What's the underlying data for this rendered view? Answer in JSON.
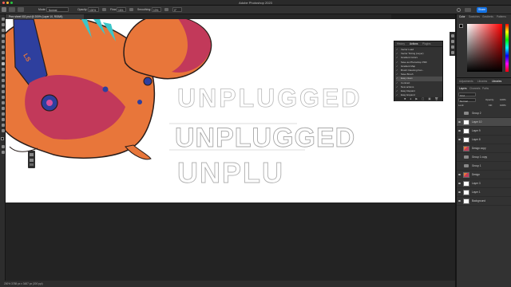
{
  "app": {
    "title": "Adobe Photoshop 2023"
  },
  "options_bar": {
    "mode_label": "Mode:",
    "mode_value": "Normal",
    "opacity_label": "Opacity:",
    "opacity_value": "100%",
    "flow_label": "Flow:",
    "flow_value": "16%",
    "smoothing_label": "Smoothing:",
    "smoothing_value": "10%",
    "angle_value": "0°",
    "share_label": "Share"
  },
  "document": {
    "tab_label": "Prev sheet 002.psd @ 200% (Layer 10, RGB/8)",
    "zoom_level": "200%"
  },
  "status_bar": {
    "text": "200%    3788 px x 3487 px (300 ppi)"
  },
  "actions_panel": {
    "tabs": [
      "History",
      "Actions",
      "Plugins"
    ],
    "active_tab": "Actions",
    "items": [
      {
        "label": "Vector Load",
        "checked": true
      },
      {
        "label": "Vector Tinting (Layer)",
        "checked": true
      },
      {
        "label": "Gradient Colors",
        "checked": true
      },
      {
        "label": "Save as Photoshop PDF",
        "checked": true
      },
      {
        "label": "Gradient Map",
        "checked": true
      },
      {
        "label": "Brush Cleaning Fan...",
        "checked": true
      },
      {
        "label": "Save Brush",
        "checked": true
      },
      {
        "label": "Easy clean",
        "checked": true,
        "selected": true
      },
      {
        "label": "Contract",
        "checked": true
      },
      {
        "label": "New actions",
        "checked": true
      },
      {
        "label": "Easy Repaint",
        "checked": true
      },
      {
        "label": "Easy Expand",
        "checked": true
      }
    ],
    "footer_icons": "■ ● ▶ ▢ ▣ 🗑"
  },
  "color_panel": {
    "tabs": [
      "Color",
      "Swatches",
      "Gradients",
      "Patterns"
    ],
    "foreground": "#000000",
    "background": "#ffffff"
  },
  "adjustments_panel": {
    "tabs": [
      "Adjustments",
      "Libraries",
      "Libraries"
    ]
  },
  "layers_panel": {
    "tabs": [
      "Layers",
      "Channels",
      "Paths"
    ],
    "kind_label": "Kind",
    "blend_mode": "Normal",
    "opacity_label": "Opacity:",
    "opacity_value": "100%",
    "lock_label": "Lock:",
    "fill_label": "Fill:",
    "fill_value": "100%",
    "layers": [
      {
        "name": "Group 2",
        "type": "group",
        "visible": false
      },
      {
        "name": "Layer 10",
        "type": "layer",
        "visible": true,
        "selected": true
      },
      {
        "name": "Layer 9",
        "type": "layer",
        "visible": true
      },
      {
        "name": "Layer 8",
        "type": "layer",
        "visible": true
      },
      {
        "name": "Design copy",
        "type": "image",
        "visible": false
      },
      {
        "name": "Group 1 copy",
        "type": "group",
        "visible": false
      },
      {
        "name": "Group 1",
        "type": "group",
        "visible": false
      },
      {
        "name": "Design",
        "type": "image",
        "visible": true
      },
      {
        "name": "Layer 3",
        "type": "layer",
        "visible": true
      },
      {
        "name": "Layer 1",
        "type": "layer",
        "visible": true
      },
      {
        "name": "Background",
        "type": "layer",
        "visible": true
      }
    ]
  },
  "canvas": {
    "lettering_top": "UNPLUGGED",
    "lettering_mid": "UNPLUGGED",
    "lettering_bottom": "UNPLU"
  },
  "colors": {
    "character_orange": "#e8763a",
    "character_red": "#c2395a",
    "character_blue": "#2e3f9e",
    "accent_teal": "#3cc6c9",
    "share_blue": "#1473e6"
  }
}
